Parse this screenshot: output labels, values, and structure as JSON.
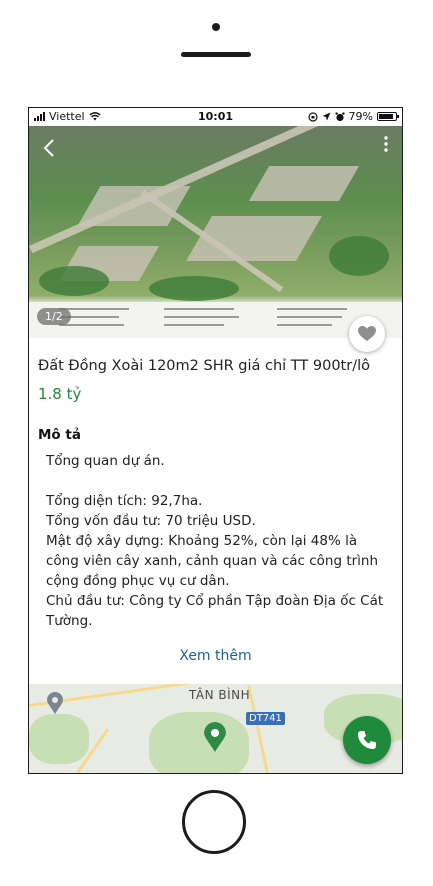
{
  "status_bar": {
    "carrier": "Viettel",
    "time": "10:01",
    "battery": "79%",
    "battery_level": 0.79
  },
  "gallery": {
    "counter": "1/2"
  },
  "listing": {
    "title": "Đất Đồng Xoài 120m2 SHR giá chỉ TT 900tr/lô",
    "price": "1.8 tỷ"
  },
  "description": {
    "heading": "Mô tả",
    "lines": [
      "Tổng quan dự án.",
      "",
      "Tổng diện tích: 92,7ha.",
      "Tổng vốn đầu tư: 70 triệu USD.",
      "Mật độ xây dựng: Khoảng 52%, còn lại 48% là công viên cây xanh, cảnh quan và các công trình cộng đồng phục vụ cư dân.",
      "Chủ đầu tư: Công ty Cổ phần Tập đoàn Địa ốc Cát Tường."
    ],
    "more_label": "Xem thêm"
  },
  "map": {
    "area_label": "TÂN BÌNH",
    "road_badge": "DT741"
  },
  "colors": {
    "price": "#1f8a3c",
    "link": "#1a5fa8",
    "call": "#1f8a3c"
  },
  "icons": [
    "back-arrow-icon",
    "more-vertical-icon",
    "heart-icon",
    "location-pin-icon",
    "phone-icon",
    "wifi-icon",
    "signal-icon",
    "battery-icon",
    "location-arrow-icon",
    "alarm-icon",
    "rotation-lock-icon"
  ]
}
